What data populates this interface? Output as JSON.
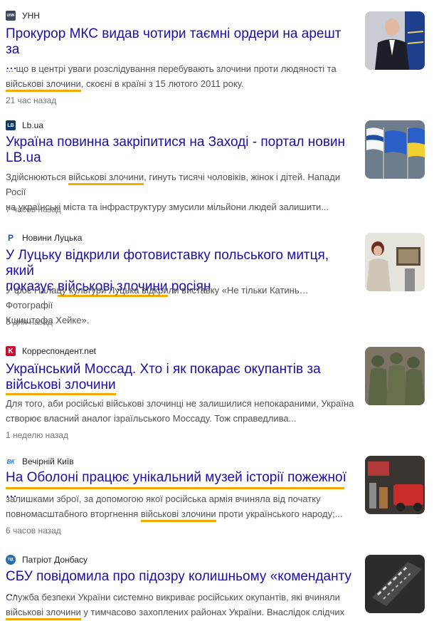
{
  "colors": {
    "title": "#1a0dab",
    "highlight_underline": "#f2a900",
    "snippet": "#4d5156",
    "time": "#70757a"
  },
  "items": [
    {
      "source": "УНН",
      "logo_text": "UNN",
      "logo_color": "#3b4a5c",
      "title_lines": [
        "Прокурор МКС видав чотири таємні ордери на арешт за",
        "..."
      ],
      "snippet_lines": [
        [
          "... що в центрі уваги розслідування перебувають злочини проти людяності та"
        ],
        [
          "",
          "військові злочини",
          ", скоєні в країні з 15 лютого 2011 року."
        ]
      ],
      "time": "21 час назад",
      "thumb_icon": "prosecutor-photo-icon"
    },
    {
      "source": "Lb.ua",
      "logo_text": "LB",
      "logo_color": "#0d3b66",
      "title_lines": [
        "Україна повинна закріпитися на Заході - портал новин",
        "LB.ua"
      ],
      "snippet_lines": [
        [
          "Здійснюються ",
          "військові злочини",
          ", гинуть тисячі чоловіків, жінок і дітей. Напади Росії"
        ],
        [
          "на українські міста та інфраструктуру змусили мільйони людей залишити..."
        ]
      ],
      "time": "7 часов назад",
      "thumb_icon": "flags-photo-icon"
    },
    {
      "source": "Новини Луцька",
      "logo_text": "P",
      "logo_color": "#1e4fa3",
      "title_lines": [
        "У Луцьку відкрили фотовиставку польського митця, який",
        "показує ",
        "військові злочини",
        " росіян"
      ],
      "snippet_lines": [
        [
          "У фоє Палацу культури Луцька відкрили виставку «Не тільки Катинь… Фотографії"
        ],
        [
          "Кшиштофа Хейке»."
        ]
      ],
      "time": "3 дня назад",
      "thumb_icon": "exhibition-photo-icon"
    },
    {
      "source": "Корреспондент.net",
      "logo_text": "K",
      "logo_color": "#c8102e",
      "title_lines": [
        "Український Моссад. Хто і як покарає окупантів за",
        "військові злочини"
      ],
      "snippet_lines": [
        [
          "Для того, аби російські військові злочинці не залишилися непокараними, Україна"
        ],
        [
          "створює власний аналог ізраїльського Моссаду. Тож справедлива..."
        ]
      ],
      "time": "1 неделю назад",
      "thumb_icon": "soldiers-photo-icon"
    },
    {
      "source": "Вечірній Київ",
      "logo_text": "ВК",
      "logo_color": "#2a6fd6",
      "title_lines": [
        "На Оболоні працює унікальний музей історії пожежної ..."
      ],
      "snippet_lines": [
        [
          "залишками зброї, за допомогою якої російська армія вчиняла від початку"
        ],
        [
          "повномасштабного вторгнення ",
          "військові злочини",
          " проти українського народу;..."
        ]
      ],
      "time": "6 часов назад",
      "thumb_icon": "fire-museum-photo-icon"
    },
    {
      "source": "Патріот Донбасу",
      "logo_text": "ПД",
      "logo_color": "#2b6cb0",
      "title_lines": [
        "СБУ повідомила про підозру колишньому «коменданту ..."
      ],
      "snippet_lines": [
        [
          "Служба безпеки України системно викриває російських окупантів, які вчиняли"
        ],
        [
          "",
          "військові злочини",
          " у тимчасово захоплених районах України. Внаслідок слідчих"
        ]
      ],
      "time": "",
      "thumb_icon": "sbu-sign-photo-icon"
    }
  ]
}
